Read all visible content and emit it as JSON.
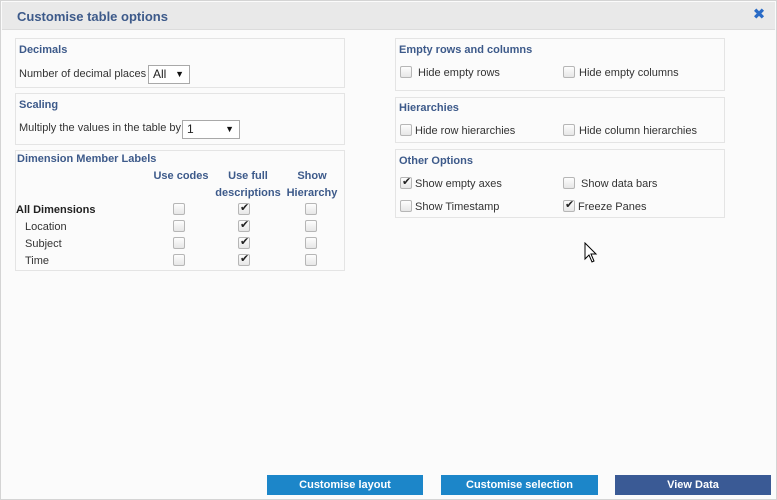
{
  "dialog": {
    "title": "Customise table options"
  },
  "decimals": {
    "title": "Decimals",
    "label": "Number of decimal places",
    "value": "All"
  },
  "scaling": {
    "title": "Scaling",
    "label": "Multiply the values in the table by",
    "value": "1"
  },
  "dimension_labels": {
    "title": "Dimension Member Labels",
    "columns": [
      "Use codes",
      "Use full descriptions",
      "Show Hierarchy"
    ],
    "col_head_lines": {
      "use_codes": [
        "Use codes"
      ],
      "full_desc": [
        "Use full",
        "descriptions"
      ],
      "hierarchy": [
        "Show",
        "Hierarchy"
      ]
    },
    "rows": [
      {
        "label": "All Dimensions",
        "use_codes": false,
        "full_desc": true,
        "hierarchy": false
      },
      {
        "label": "Location",
        "use_codes": false,
        "full_desc": true,
        "hierarchy": false
      },
      {
        "label": "Subject",
        "use_codes": false,
        "full_desc": true,
        "hierarchy": false
      },
      {
        "label": "Time",
        "use_codes": false,
        "full_desc": true,
        "hierarchy": false
      }
    ]
  },
  "empty_rows_cols": {
    "title": "Empty rows and columns",
    "hide_rows": {
      "label": "Hide empty rows",
      "checked": false
    },
    "hide_cols": {
      "label": "Hide empty columns",
      "checked": false
    }
  },
  "hierarchies": {
    "title": "Hierarchies",
    "hide_row": {
      "label": "Hide row hierarchies",
      "checked": false
    },
    "hide_col": {
      "label": "Hide column hierarchies",
      "checked": false
    }
  },
  "other_options": {
    "title": "Other Options",
    "show_empty_axes": {
      "label": "Show empty axes",
      "checked": true
    },
    "show_data_bars": {
      "label": "Show data bars",
      "checked": false
    },
    "show_timestamp": {
      "label": "Show Timestamp",
      "checked": false
    },
    "freeze_panes": {
      "label": "Freeze Panes",
      "checked": true
    }
  },
  "buttons": {
    "customise_layout": "Customise layout",
    "customise_selection": "Customise selection",
    "view_data": "View Data"
  },
  "icons": {
    "close": "close-icon",
    "dropdown": "chevron-down-icon",
    "cursor": "mouse-pointer-icon"
  },
  "colors": {
    "title_text": "#3d5a8a",
    "close_icon": "#2a6bc6",
    "button_light": "#1c86c9",
    "button_dark": "#3a5a95"
  }
}
